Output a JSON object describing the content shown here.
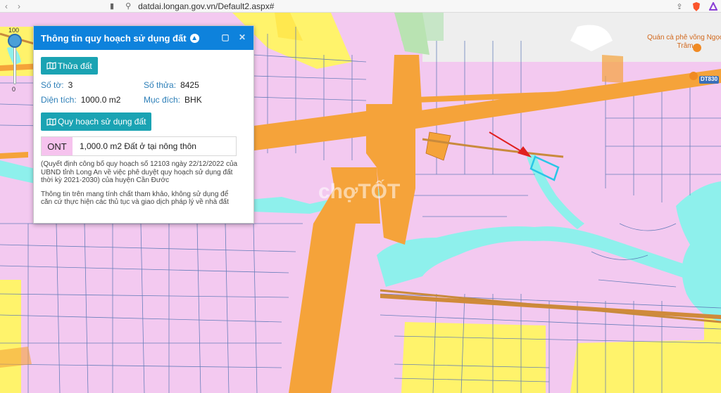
{
  "browser": {
    "url": "datdai.longan.gov.vn/Default2.aspx#",
    "back_icon": "back-arrow-icon",
    "forward_icon": "forward-arrow-icon"
  },
  "zoom": {
    "max_label": "100",
    "min_label": "0"
  },
  "panel": {
    "title": "Thông tin quy hoạch sử dụng đất",
    "thua_dat_button": "Thửa đất",
    "so_to_label": "Số tờ:",
    "so_to_value": "3",
    "so_thua_label": "Số thửa:",
    "so_thua_value": "8425",
    "dien_tich_label": "Diện tích:",
    "dien_tich_value": "1000.0 m2",
    "muc_dich_label": "Mục đích:",
    "muc_dich_value": "BHK",
    "quy_hoach_button": "Quy hoạch sử dụng đất",
    "ont_code": "ONT",
    "ont_desc": "1,000.0 m2 Đất ở tại nông thôn",
    "decision_note": "(Quyết định công bố quy hoạch số 12103 ngày 22/12/2022 của UBND tỉnh Long An về việc phê duyệt quy hoạch sử dụng đất thời kỳ 2021-2030) của huyện Cần Đước",
    "disclaimer": "Thông tin trên mang tính chất tham khảo, không sử dụng để căn cứ thực hiện các thủ tục và giao dịch pháp lý về nhà đất"
  },
  "map": {
    "poi_name": "Quán cà phê võng Ngọc Trâm",
    "road_label": "DT830",
    "watermark": "chợTỐT",
    "colors": {
      "residential": "#f3c9f0",
      "road": "#f5a33a",
      "water": "#8ef0ec",
      "agriculture": "#fff36b",
      "parcel_line": "#5a77b5",
      "highlight": "#29c6e6",
      "arrow": "#e02020"
    }
  }
}
